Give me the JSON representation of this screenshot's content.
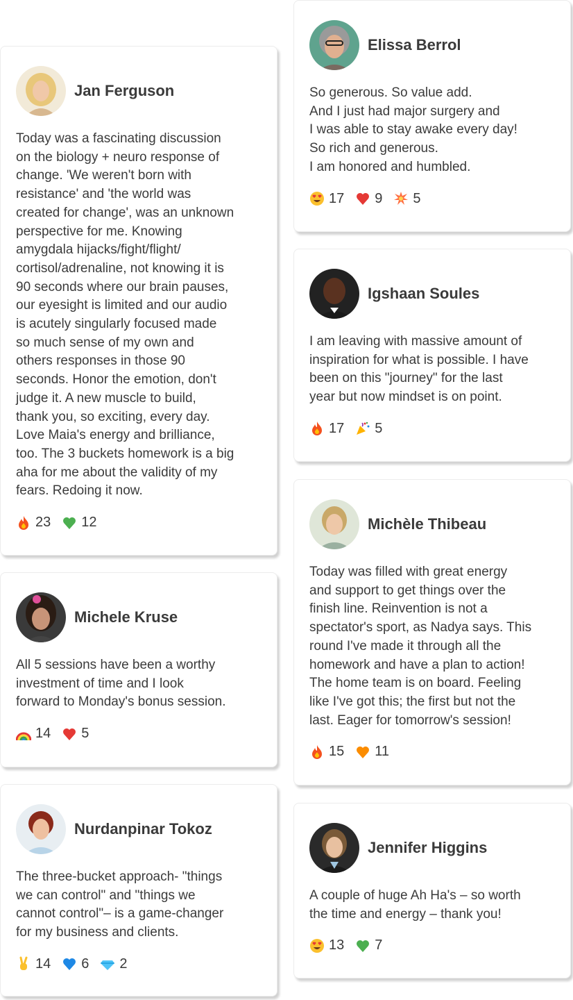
{
  "testimonials": [
    {
      "name": "Jan Ferguson",
      "text": "Today was a fascinating discussion\non the biology + neuro response of\nchange. 'We weren't born with\nresistance' and 'the world was\ncreated for change', was an unknown\nperspective for me. Knowing\namygdala hijacks/fight/flight/\ncortisol/adrenaline, not knowing it is\n90 seconds where our brain pauses,\nour eyesight is limited and our audio\nis acutely singularly focused made\nso much sense of my own and\nothers responses in those 90\nseconds. Honor the emotion, don't\njudge it. A new muscle to build,\nthank you, so exciting, every day.\nLove Maia's energy and brilliance,\ntoo. The 3 buckets homework is a big\naha for me about the validity of my\nfears. Redoing it now.",
      "reactions": [
        {
          "icon": "fire-emoji",
          "count": "23"
        },
        {
          "icon": "green-heart-emoji",
          "count": "12"
        }
      ]
    },
    {
      "name": "Michele Kruse",
      "text": "All 5 sessions have been a worthy\ninvestment of time and I look\nforward to Monday's bonus session.",
      "reactions": [
        {
          "icon": "rainbow-emoji",
          "count": "14"
        },
        {
          "icon": "red-heart-emoji",
          "count": "5"
        }
      ]
    },
    {
      "name": "Nurdanpinar Tokoz",
      "text": "The three-bucket approach-  \"things\nwe can control\" and \"things we\ncannot control\"– is a game-changer\nfor my business and clients.",
      "reactions": [
        {
          "icon": "victory-hand-emoji",
          "count": "14"
        },
        {
          "icon": "blue-heart-emoji",
          "count": "6"
        },
        {
          "icon": "gem-emoji",
          "count": "2"
        }
      ]
    },
    {
      "name": "Elissa Berrol",
      "text": "So generous. So value add.\nAnd I just had major surgery and\nI was able to stay awake every day!\nSo rich and generous.\nI am honored and humbled.",
      "reactions": [
        {
          "icon": "heart-eyes-emoji",
          "count": "17"
        },
        {
          "icon": "red-heart-emoji",
          "count": "9"
        },
        {
          "icon": "collision-emoji",
          "count": "5"
        }
      ]
    },
    {
      "name": "Igshaan Soules",
      "text": "I am leaving with massive amount of\ninspiration for what is possible. I have\nbeen on this \"journey\" for the last\nyear but now mindset is on point.",
      "reactions": [
        {
          "icon": "fire-emoji",
          "count": "17"
        },
        {
          "icon": "party-popper-emoji",
          "count": "5"
        }
      ]
    },
    {
      "name": "Michèle Thibeau",
      "text": "Today was filled with great energy\nand support to get things over the\nfinish line. Reinvention is not a\nspectator's sport, as Nadya says. This\nround I've made it through all the\nhomework and have a plan to action!\nThe home team is on board. Feeling\nlike I've got this; the first but not the\nlast. Eager for tomorrow's session!",
      "reactions": [
        {
          "icon": "fire-emoji",
          "count": "15"
        },
        {
          "icon": "orange-heart-emoji",
          "count": "11"
        }
      ]
    },
    {
      "name": "Jennifer Higgins",
      "text": "A couple of huge Ah Ha's – so worth\nthe time and energy – thank you!",
      "reactions": [
        {
          "icon": "heart-eyes-emoji",
          "count": "13"
        },
        {
          "icon": "green-heart-emoji",
          "count": "7"
        }
      ]
    }
  ]
}
